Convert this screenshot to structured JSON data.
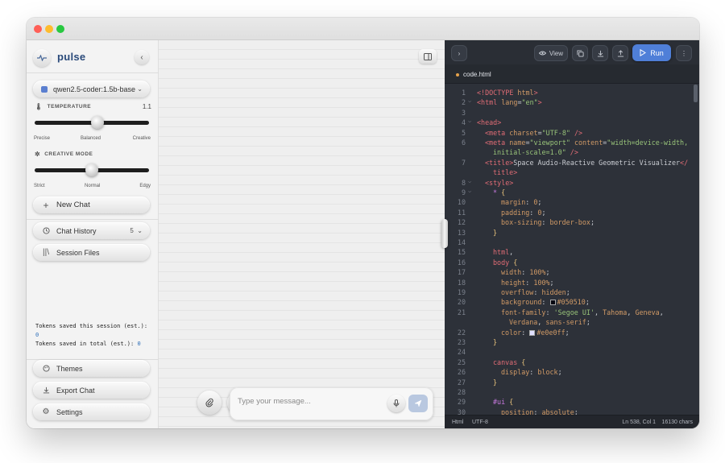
{
  "app": {
    "name": "pulse"
  },
  "sidebar": {
    "model": "qwen2.5-coder:1.5b-base",
    "temperature": {
      "label": "TEMPERATURE",
      "value": "1.1",
      "level": 0.55,
      "ticks": [
        "Precise",
        "Balanced",
        "Creative"
      ]
    },
    "creative_mode": {
      "label": "CREATIVE MODE",
      "level": 0.5,
      "ticks": [
        "Strict",
        "Normal",
        "Edgy"
      ]
    },
    "new_chat": "New Chat",
    "chat_history": {
      "label": "Chat History",
      "count": "5"
    },
    "session_files": "Session Files",
    "tokens_session_label": "Tokens saved this session (est.):",
    "tokens_session_value": "0",
    "tokens_total_label": "Tokens saved in total (est.):",
    "tokens_total_value": "0",
    "themes": "Themes",
    "export_chat": "Export Chat",
    "settings": "Settings"
  },
  "chat": {
    "input_placeholder": "Type your message..."
  },
  "editor": {
    "toolbar": {
      "view_label": "View",
      "run_label": "Run"
    },
    "tab": "code.html",
    "status": {
      "language": "Html",
      "encoding": "UTF-8",
      "position": "Ln 538, Col 1",
      "chars": "16130 chars"
    },
    "lines": [
      {
        "n": "1",
        "fold": "",
        "indent": 0,
        "tokens": [
          [
            "c-tag",
            "<!DOCTYPE "
          ],
          [
            "c-attr",
            "html"
          ],
          [
            "c-tag",
            ">"
          ]
        ]
      },
      {
        "n": "2",
        "fold": "⌵",
        "indent": 0,
        "tokens": [
          [
            "c-tag",
            "<html "
          ],
          [
            "c-attr",
            "lang"
          ],
          [
            "c-pun",
            "="
          ],
          [
            "c-str",
            "\"en\""
          ],
          [
            "c-tag",
            ">"
          ]
        ]
      },
      {
        "n": "3",
        "fold": "",
        "indent": 0,
        "tokens": []
      },
      {
        "n": "4",
        "fold": "⌵",
        "indent": 0,
        "tokens": [
          [
            "c-tag",
            "<head>"
          ]
        ]
      },
      {
        "n": "5",
        "fold": "",
        "indent": 1,
        "tokens": [
          [
            "c-tag",
            "<meta "
          ],
          [
            "c-attr",
            "charset"
          ],
          [
            "c-pun",
            "="
          ],
          [
            "c-str",
            "\"UTF-8\""
          ],
          [
            "c-tag",
            " />"
          ]
        ]
      },
      {
        "n": "6",
        "fold": "",
        "indent": 1,
        "tokens": [
          [
            "c-tag",
            "<meta "
          ],
          [
            "c-attr",
            "name"
          ],
          [
            "c-pun",
            "="
          ],
          [
            "c-str",
            "\"viewport\""
          ],
          [
            "c-pun",
            " "
          ],
          [
            "c-attr",
            "content"
          ],
          [
            "c-pun",
            "="
          ],
          [
            "c-str",
            "\"width=device-width,"
          ]
        ]
      },
      {
        "n": "",
        "fold": "",
        "indent": 2,
        "tokens": [
          [
            "c-str",
            "initial-scale=1.0\""
          ],
          [
            "c-tag",
            " />"
          ]
        ]
      },
      {
        "n": "7",
        "fold": "",
        "indent": 1,
        "tokens": [
          [
            "c-tag",
            "<title>"
          ],
          [
            "c-pun",
            "Space Audio-Reactive Geometric Visualizer"
          ],
          [
            "c-tag",
            "</"
          ]
        ]
      },
      {
        "n": "",
        "fold": "",
        "indent": 2,
        "tokens": [
          [
            "c-tag",
            "title>"
          ]
        ]
      },
      {
        "n": "8",
        "fold": "⌵",
        "indent": 1,
        "tokens": [
          [
            "c-tag",
            "<style>"
          ]
        ]
      },
      {
        "n": "9",
        "fold": "⌵",
        "indent": 2,
        "tokens": [
          [
            "c-sel",
            "* "
          ],
          [
            "c-prop",
            "{"
          ]
        ]
      },
      {
        "n": "10",
        "fold": "",
        "indent": 3,
        "tokens": [
          [
            "c-attr",
            "margin"
          ],
          [
            "c-pun",
            ": "
          ],
          [
            "c-val",
            "0"
          ],
          [
            "c-pun",
            ";"
          ]
        ]
      },
      {
        "n": "11",
        "fold": "",
        "indent": 3,
        "tokens": [
          [
            "c-attr",
            "padding"
          ],
          [
            "c-pun",
            ": "
          ],
          [
            "c-val",
            "0"
          ],
          [
            "c-pun",
            ";"
          ]
        ]
      },
      {
        "n": "12",
        "fold": "",
        "indent": 3,
        "tokens": [
          [
            "c-attr",
            "box-sizing"
          ],
          [
            "c-pun",
            ": "
          ],
          [
            "c-val",
            "border-box"
          ],
          [
            "c-pun",
            ";"
          ]
        ]
      },
      {
        "n": "13",
        "fold": "",
        "indent": 2,
        "tokens": [
          [
            "c-prop",
            "}"
          ]
        ]
      },
      {
        "n": "14",
        "fold": "",
        "indent": 0,
        "tokens": []
      },
      {
        "n": "15",
        "fold": "",
        "indent": 2,
        "tokens": [
          [
            "c-tag",
            "html"
          ],
          [
            "c-pun",
            ","
          ]
        ]
      },
      {
        "n": "16",
        "fold": "",
        "indent": 2,
        "tokens": [
          [
            "c-tag",
            "body "
          ],
          [
            "c-prop",
            "{"
          ]
        ]
      },
      {
        "n": "17",
        "fold": "",
        "indent": 3,
        "tokens": [
          [
            "c-attr",
            "width"
          ],
          [
            "c-pun",
            ": "
          ],
          [
            "c-val",
            "100%"
          ],
          [
            "c-pun",
            ";"
          ]
        ]
      },
      {
        "n": "18",
        "fold": "",
        "indent": 3,
        "tokens": [
          [
            "c-attr",
            "height"
          ],
          [
            "c-pun",
            ": "
          ],
          [
            "c-val",
            "100%"
          ],
          [
            "c-pun",
            ";"
          ]
        ]
      },
      {
        "n": "19",
        "fold": "",
        "indent": 3,
        "tokens": [
          [
            "c-attr",
            "overflow"
          ],
          [
            "c-pun",
            ": "
          ],
          [
            "c-val",
            "hidden"
          ],
          [
            "c-pun",
            ";"
          ]
        ]
      },
      {
        "n": "20",
        "fold": "",
        "indent": 3,
        "tokens": [
          [
            "c-attr",
            "background"
          ],
          [
            "c-pun",
            ": "
          ],
          [
            "swatch:#050510",
            ""
          ],
          [
            "c-val",
            "#050510"
          ],
          [
            "c-pun",
            ";"
          ]
        ]
      },
      {
        "n": "21",
        "fold": "",
        "indent": 3,
        "tokens": [
          [
            "c-attr",
            "font-family"
          ],
          [
            "c-pun",
            ": "
          ],
          [
            "c-str",
            "'Segoe UI'"
          ],
          [
            "c-pun",
            ", "
          ],
          [
            "c-val",
            "Tahoma"
          ],
          [
            "c-pun",
            ", "
          ],
          [
            "c-val",
            "Geneva"
          ],
          [
            "c-pun",
            ","
          ]
        ]
      },
      {
        "n": "",
        "fold": "",
        "indent": 4,
        "tokens": [
          [
            "c-val",
            "Verdana"
          ],
          [
            "c-pun",
            ", "
          ],
          [
            "c-val",
            "sans-serif"
          ],
          [
            "c-pun",
            ";"
          ]
        ]
      },
      {
        "n": "22",
        "fold": "",
        "indent": 3,
        "tokens": [
          [
            "c-attr",
            "color"
          ],
          [
            "c-pun",
            ": "
          ],
          [
            "swatch:#e0e0ff",
            ""
          ],
          [
            "c-val",
            "#e0e0ff"
          ],
          [
            "c-pun",
            ";"
          ]
        ]
      },
      {
        "n": "23",
        "fold": "",
        "indent": 2,
        "tokens": [
          [
            "c-prop",
            "}"
          ]
        ]
      },
      {
        "n": "24",
        "fold": "",
        "indent": 0,
        "tokens": []
      },
      {
        "n": "25",
        "fold": "",
        "indent": 2,
        "tokens": [
          [
            "c-tag",
            "canvas "
          ],
          [
            "c-prop",
            "{"
          ]
        ]
      },
      {
        "n": "26",
        "fold": "",
        "indent": 3,
        "tokens": [
          [
            "c-attr",
            "display"
          ],
          [
            "c-pun",
            ": "
          ],
          [
            "c-val",
            "block"
          ],
          [
            "c-pun",
            ";"
          ]
        ]
      },
      {
        "n": "27",
        "fold": "",
        "indent": 2,
        "tokens": [
          [
            "c-prop",
            "}"
          ]
        ]
      },
      {
        "n": "28",
        "fold": "",
        "indent": 0,
        "tokens": []
      },
      {
        "n": "29",
        "fold": "",
        "indent": 2,
        "tokens": [
          [
            "c-sel",
            "#ui "
          ],
          [
            "c-prop",
            "{"
          ]
        ]
      },
      {
        "n": "30",
        "fold": "",
        "indent": 3,
        "tokens": [
          [
            "c-attr",
            "position"
          ],
          [
            "c-pun",
            ": "
          ],
          [
            "c-val",
            "absolute"
          ],
          [
            "c-pun",
            ";"
          ]
        ]
      }
    ]
  }
}
